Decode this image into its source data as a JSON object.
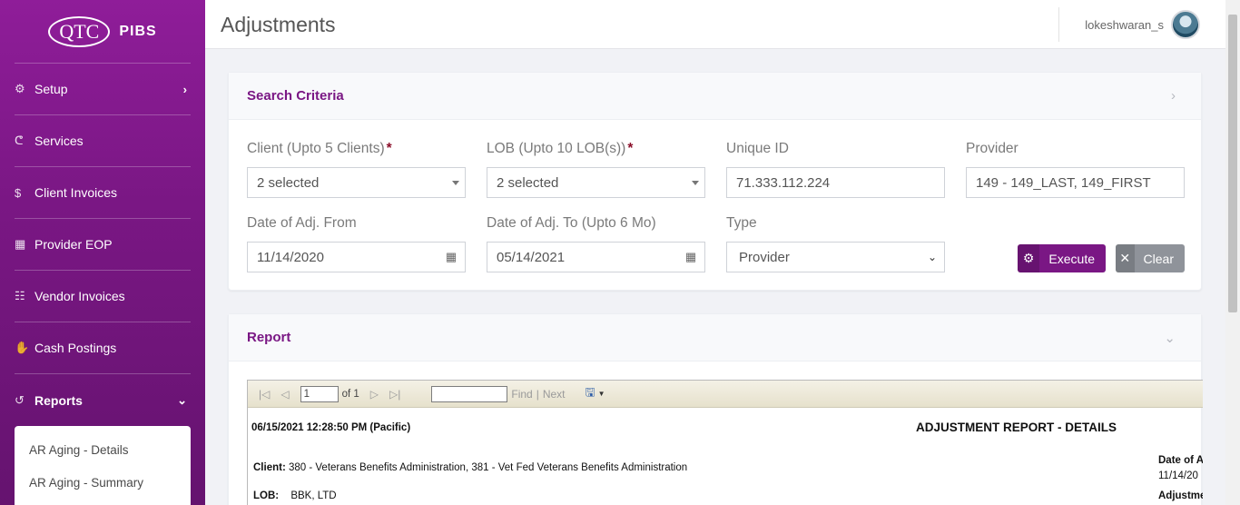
{
  "brand": {
    "logo_mark": "QTC",
    "app_name": "PIBS"
  },
  "sidebar": {
    "items": [
      {
        "label": "Setup",
        "icon": "gear-icon",
        "chevron": "›"
      },
      {
        "label": "Services",
        "icon": "stethoscope-icon"
      },
      {
        "label": "Client Invoices",
        "icon": "dollar-icon"
      },
      {
        "label": "Provider EOP",
        "icon": "calendar-icon"
      },
      {
        "label": "Vendor Invoices",
        "icon": "table-icon"
      },
      {
        "label": "Cash Postings",
        "icon": "hand-money-icon"
      },
      {
        "label": "Reports",
        "icon": "history-icon",
        "chevron": "⌄"
      }
    ],
    "submenu": [
      "AR Aging - Details",
      "AR Aging - Summary"
    ]
  },
  "header": {
    "title": "Adjustments",
    "username": "lokeshwaran_s"
  },
  "search": {
    "title": "Search Criteria",
    "toggle": "›",
    "client_label": "Client (Upto 5 Clients)",
    "client_value": "2 selected",
    "lob_label": "LOB (Upto 10 LOB(s))",
    "lob_value": "2 selected",
    "required_mark": "*",
    "unique_id_label": "Unique ID",
    "unique_id_value": "71.333.112.224",
    "provider_label": "Provider",
    "provider_value": "149 - 149_LAST, 149_FIRST",
    "date_from_label": "Date of Adj. From",
    "date_from_value": "11/14/2020",
    "date_to_label": "Date of Adj. To (Upto 6 Mo)",
    "date_to_value": "05/14/2021",
    "type_label": "Type",
    "type_value": "Provider",
    "execute_label": "Execute",
    "clear_label": "Clear"
  },
  "report": {
    "title": "Report",
    "toggle": "⌄",
    "toolbar": {
      "page_value": "1",
      "of_text": "of 1",
      "find_label": "Find",
      "separator": "|",
      "next_label": "Next"
    },
    "timestamp": "06/15/2021 12:28:50 PM (Pacific)",
    "heading": "ADJUSTMENT REPORT - DETAILS",
    "client_label": "Client:",
    "client_value": "380 - Veterans Benefits Administration, 381 - Vet Fed Veterans Benefits Administration",
    "lob_label": "LOB:",
    "lob_value": "BBK, LTD",
    "date_header": "Date of A",
    "date_value": "11/14/20",
    "adjustment_header": "Adjustme"
  }
}
